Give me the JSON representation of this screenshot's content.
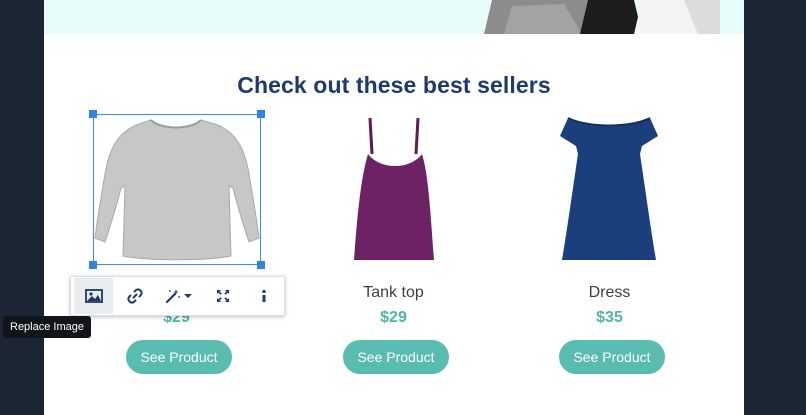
{
  "section": {
    "title": "Check out these best sellers"
  },
  "products": [
    {
      "name": "",
      "price": "$29",
      "button_label": "See Product"
    },
    {
      "name": "Tank top",
      "price": "$29",
      "button_label": "See Product"
    },
    {
      "name": "Dress",
      "price": "$35",
      "button_label": "See Product"
    }
  ],
  "toolbar": {
    "buttons": [
      {
        "icon": "image-icon"
      },
      {
        "icon": "link-icon"
      },
      {
        "icon": "magic-wand-icon"
      },
      {
        "icon": "expand-icon"
      },
      {
        "icon": "info-icon"
      }
    ],
    "tooltip": "Replace Image"
  },
  "colors": {
    "title": "#1f3a6b",
    "price": "#4fb5a6",
    "button": "#58bcae",
    "selection": "#2f84e0",
    "background": "#1c2533"
  }
}
